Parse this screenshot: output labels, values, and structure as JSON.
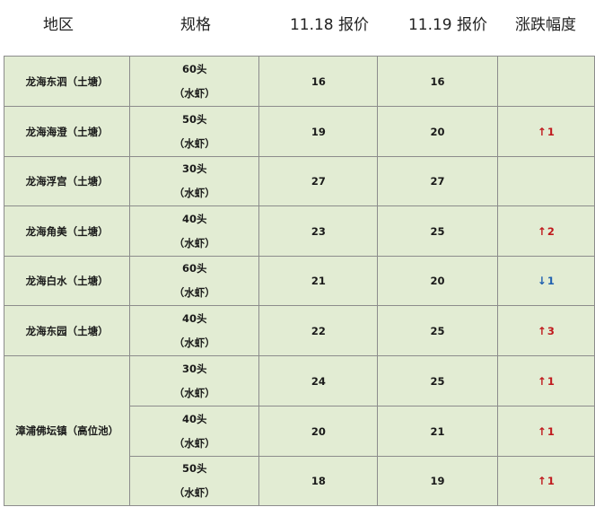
{
  "header": {
    "region": "地区",
    "spec": "规格",
    "price_1118": "11.18 报价",
    "price_1119": "11.19 报价",
    "change": "涨跌幅度"
  },
  "rows": [
    {
      "region": "龙海东泗（土塘）",
      "spec_count": "60头",
      "spec_type": "（水虾）",
      "p1": "16",
      "p2": "16",
      "change": "",
      "direction": ""
    },
    {
      "region": "龙海海澄（土塘）",
      "spec_count": "50头",
      "spec_type": "（水虾）",
      "p1": "19",
      "p2": "20",
      "change": "1",
      "direction": "up"
    },
    {
      "region": "龙海浮宫（土塘）",
      "spec_count": "30头",
      "spec_type": "（水虾）",
      "p1": "27",
      "p2": "27",
      "change": "",
      "direction": ""
    },
    {
      "region": "龙海角美（土塘）",
      "spec_count": "40头",
      "spec_type": "（水虾）",
      "p1": "23",
      "p2": "25",
      "change": "2",
      "direction": "up"
    },
    {
      "region": "龙海白水（土塘）",
      "spec_count": "60头",
      "spec_type": "（水虾）",
      "p1": "21",
      "p2": "20",
      "change": "1",
      "direction": "down"
    },
    {
      "region": "龙海东园（土塘）",
      "spec_count": "40头",
      "spec_type": "（水虾）",
      "p1": "22",
      "p2": "25",
      "change": "3",
      "direction": "up"
    },
    {
      "region": "漳浦佛坛镇（高位池）",
      "spec_count": "30头",
      "spec_type": "（水虾）",
      "p1": "24",
      "p2": "25",
      "change": "1",
      "direction": "up"
    },
    {
      "region": "",
      "spec_count": "40头",
      "spec_type": "（水虾）",
      "p1": "20",
      "p2": "21",
      "change": "1",
      "direction": "up"
    },
    {
      "region": "",
      "spec_count": "50头",
      "spec_type": "（水虾）",
      "p1": "18",
      "p2": "19",
      "change": "1",
      "direction": "up"
    }
  ],
  "colors": {
    "table_bg": "#e2ecd3",
    "border": "#8c8c8c",
    "up": "#c0191d",
    "down": "#2060b0"
  },
  "icons": {
    "up": "arrow-up-icon",
    "down": "arrow-down-icon"
  }
}
